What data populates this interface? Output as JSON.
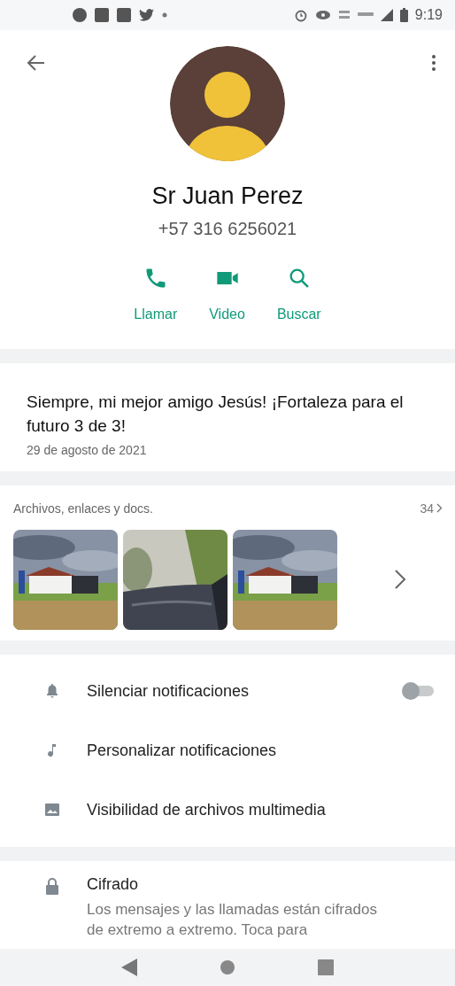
{
  "status_bar": {
    "time": "9:19"
  },
  "contact": {
    "name": "Sr Juan Perez",
    "phone": "+57 316 6256021"
  },
  "actions": [
    {
      "kind": "call",
      "label": "Llamar"
    },
    {
      "kind": "video",
      "label": "Video"
    },
    {
      "kind": "search",
      "label": "Buscar"
    }
  ],
  "about": {
    "text": "Siempre, mi mejor amigo Jesús! ¡Fortaleza para el futuro 3 de 3!",
    "date": "29 de agosto de 2021"
  },
  "media": {
    "title": "Archivos, enlaces y docs.",
    "count": "34"
  },
  "settings": [
    {
      "kind": "toggle",
      "label": "Silenciar notificaciones",
      "on": false
    },
    {
      "kind": "plain",
      "label": "Personalizar notificaciones"
    },
    {
      "kind": "plain",
      "label": "Visibilidad de archivos multimedia"
    }
  ],
  "encryption": {
    "title": "Cifrado",
    "description": "Los mensajes y las llamadas están cifrados de extremo a extremo. Toca para"
  }
}
